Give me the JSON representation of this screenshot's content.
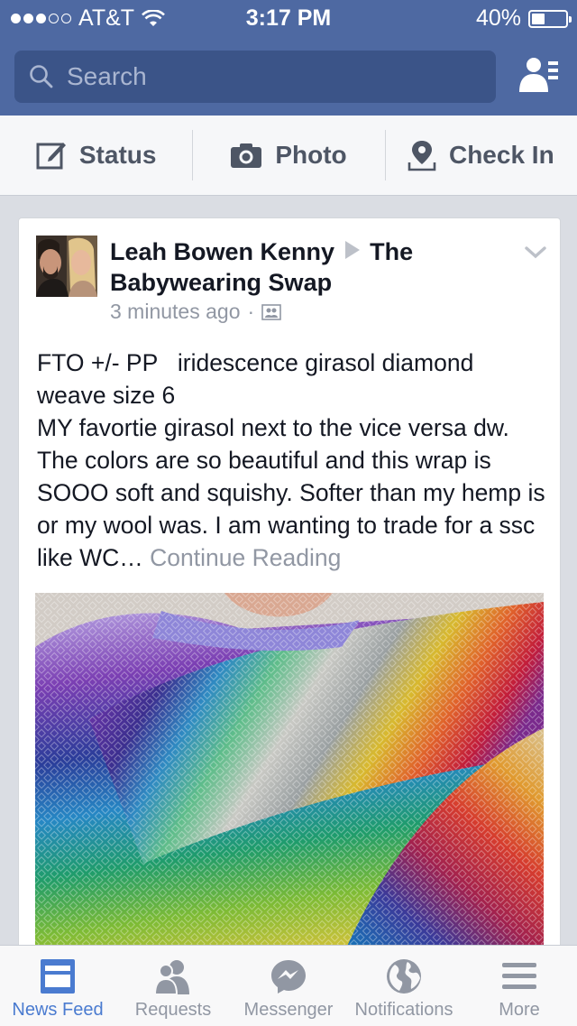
{
  "status_bar": {
    "carrier": "AT&T",
    "time": "3:17 PM",
    "battery_label": "40%",
    "battery_level": 0.4
  },
  "search": {
    "placeholder": "Search"
  },
  "composer": {
    "status_label": "Status",
    "photo_label": "Photo",
    "checkin_label": "Check In"
  },
  "post": {
    "author": "Leah Bowen Kenny",
    "group": "The Babywearing Swap",
    "timestamp": "3 minutes ago",
    "separator": "·",
    "text": "FTO +/- PP   iridescence girasol diamond weave size 6\nMY favortie girasol next to the vice versa dw. The colors are so beautiful and this wrap is SOOO soft and squishy. Softer than my hemp is or my wool was. I am wanting to trade for a ssc like WC…",
    "continue_label": "Continue Reading"
  },
  "tabs": [
    {
      "label": "News Feed",
      "icon": "news-feed-icon",
      "active": true
    },
    {
      "label": "Requests",
      "icon": "requests-icon",
      "active": false
    },
    {
      "label": "Messenger",
      "icon": "messenger-icon",
      "active": false
    },
    {
      "label": "Notifications",
      "icon": "globe-icon",
      "active": false
    },
    {
      "label": "More",
      "icon": "hamburger-icon",
      "active": false
    }
  ],
  "colors": {
    "brand": "#4e69a2",
    "active_tab": "#4a7bd0",
    "muted": "#9197a3"
  }
}
